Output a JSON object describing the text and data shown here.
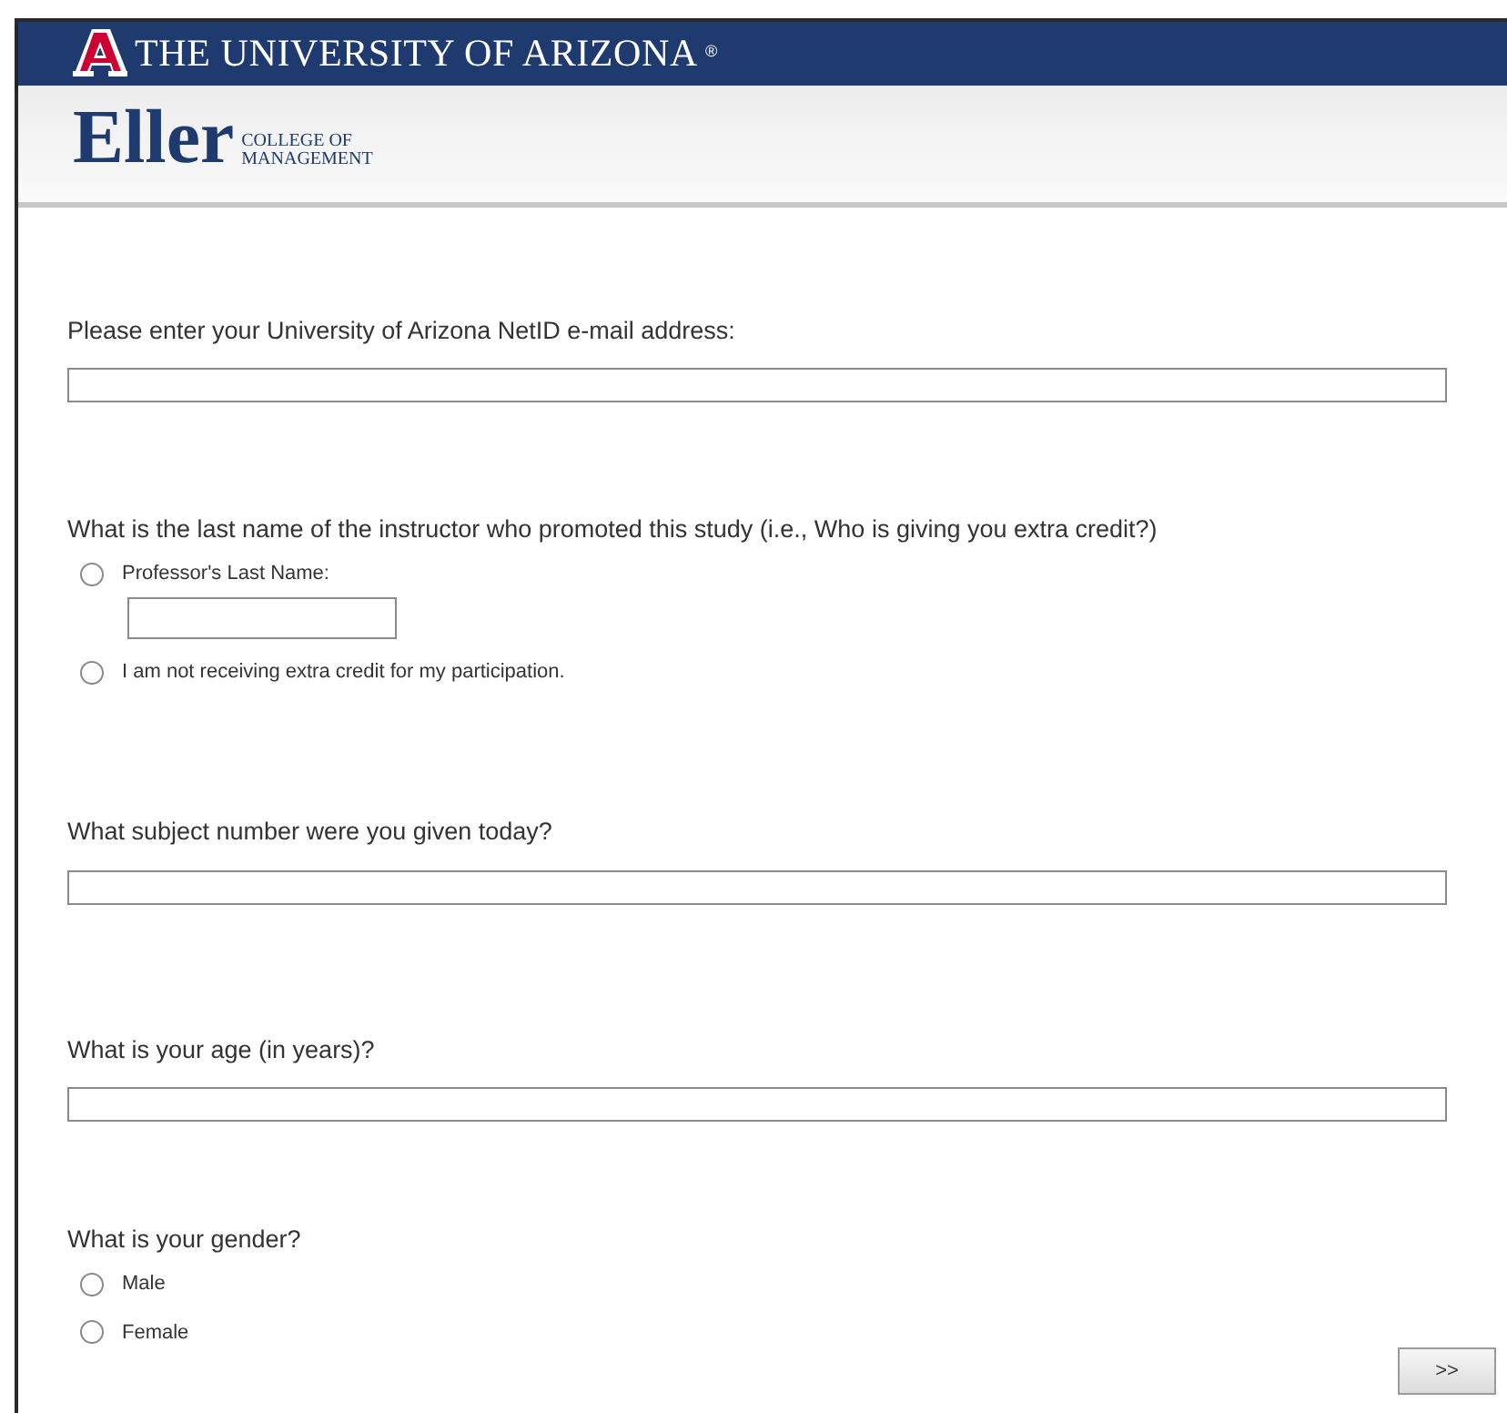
{
  "header": {
    "title": "THE UNIVERSITY OF ARIZONA",
    "mark": "®"
  },
  "brand": {
    "name": "Eller",
    "subtitle_lines": [
      "COLLEGE OF",
      "MANAGEMENT"
    ]
  },
  "questions": [
    {
      "kind": "text",
      "prompt": "Please enter your University of Arizona NetID e-mail address:"
    },
    {
      "kind": "choice",
      "prompt": "What is the last name of the instructor who promoted this study (i.e., Who is giving you extra credit?)",
      "options": [
        {
          "kind": "entry",
          "label": "Professor's Last Name:",
          "selected": false
        },
        {
          "kind": "plain",
          "label": "I am not receiving extra credit for my participation.",
          "selected": false
        }
      ]
    },
    {
      "kind": "text",
      "prompt": "What subject number were you given today?"
    },
    {
      "kind": "text",
      "prompt": "What is your age (in years)?"
    },
    {
      "kind": "choice",
      "prompt": "What is your gender?",
      "options": [
        {
          "kind": "plain",
          "label": "Male",
          "selected": false
        },
        {
          "kind": "plain",
          "label": "Female",
          "selected": false
        }
      ]
    }
  ],
  "next_button": ">>"
}
